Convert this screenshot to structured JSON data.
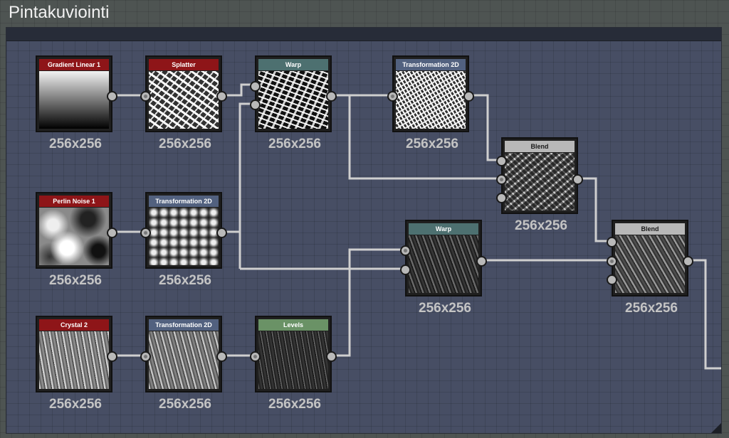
{
  "frame": {
    "title": "Pintakuviointi"
  },
  "nodes": [
    {
      "id": "gradient",
      "title": "Gradient Linear 1",
      "size": "256x256",
      "header_color": "#8e1518",
      "icon": "gradient-preview"
    },
    {
      "id": "splatter",
      "title": "Splatter",
      "size": "256x256",
      "header_color": "#8e1518",
      "icon": "splatter-preview"
    },
    {
      "id": "warp1",
      "title": "Warp",
      "size": "256x256",
      "header_color": "#4d7070",
      "icon": "warp-preview"
    },
    {
      "id": "trans1",
      "title": "Transformation 2D",
      "size": "256x256",
      "header_color": "#52617f",
      "icon": "transform-preview"
    },
    {
      "id": "blend1",
      "title": "Blend",
      "size": "256x256",
      "header_color": "#b8b8b8",
      "icon": "blend-preview"
    },
    {
      "id": "perlin",
      "title": "Perlin Noise 1",
      "size": "256x256",
      "header_color": "#8e1518",
      "icon": "perlin-preview"
    },
    {
      "id": "trans2",
      "title": "Transformation 2D",
      "size": "256x256",
      "header_color": "#52617f",
      "icon": "transform-preview"
    },
    {
      "id": "warp2",
      "title": "Warp",
      "size": "256x256",
      "header_color": "#4d7070",
      "icon": "warp-preview"
    },
    {
      "id": "blend2",
      "title": "Blend",
      "size": "256x256",
      "header_color": "#b8b8b8",
      "icon": "blend-preview"
    },
    {
      "id": "crystal",
      "title": "Crystal 2",
      "size": "256x256",
      "header_color": "#8e1518",
      "icon": "crystal-preview"
    },
    {
      "id": "trans3",
      "title": "Transformation 2D",
      "size": "256x256",
      "header_color": "#52617f",
      "icon": "transform-preview"
    },
    {
      "id": "levels",
      "title": "Levels",
      "size": "256x256",
      "header_color": "#6a9266",
      "icon": "levels-preview"
    }
  ]
}
